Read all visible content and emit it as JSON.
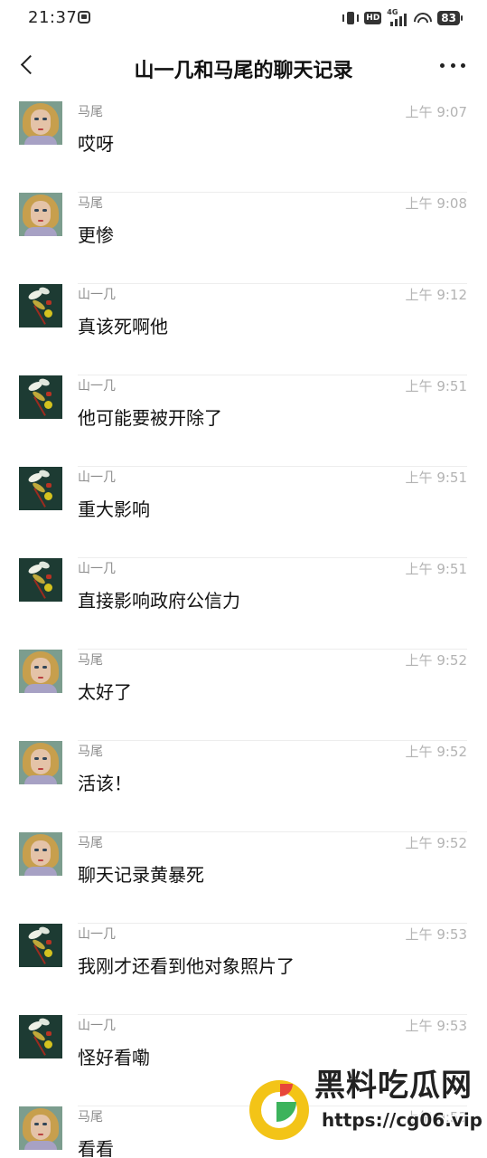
{
  "status_bar": {
    "time": "21:37",
    "hd": "HD",
    "network": "4G",
    "battery": "83"
  },
  "header": {
    "title": "山一几和马尾的聊天记录"
  },
  "messages": [
    {
      "sender": "马尾",
      "time": "上午 9:07",
      "text": "哎呀",
      "avatar": "mawei"
    },
    {
      "sender": "马尾",
      "time": "上午 9:08",
      "text": "更惨",
      "avatar": "mawei"
    },
    {
      "sender": "山一几",
      "time": "上午 9:12",
      "text": "真该死啊他",
      "avatar": "shanyiji"
    },
    {
      "sender": "山一几",
      "time": "上午 9:51",
      "text": "他可能要被开除了",
      "avatar": "shanyiji"
    },
    {
      "sender": "山一几",
      "time": "上午 9:51",
      "text": "重大影响",
      "avatar": "shanyiji"
    },
    {
      "sender": "山一几",
      "time": "上午 9:51",
      "text": "直接影响政府公信力",
      "avatar": "shanyiji"
    },
    {
      "sender": "马尾",
      "time": "上午 9:52",
      "text": "太好了",
      "avatar": "mawei"
    },
    {
      "sender": "马尾",
      "time": "上午 9:52",
      "text": "活该！",
      "avatar": "mawei"
    },
    {
      "sender": "马尾",
      "time": "上午 9:52",
      "text": "聊天记录黄暴死",
      "avatar": "mawei"
    },
    {
      "sender": "山一几",
      "time": "上午 9:53",
      "text": "我刚才还看到他对象照片了",
      "avatar": "shanyiji"
    },
    {
      "sender": "山一几",
      "time": "上午 9:53",
      "text": "怪好看嘞",
      "avatar": "shanyiji"
    },
    {
      "sender": "马尾",
      "time": "上午 9:53",
      "text": "看看",
      "avatar": "mawei"
    }
  ],
  "watermark": {
    "title": "黑料吃瓜网",
    "url": "https://cg06.vip"
  }
}
